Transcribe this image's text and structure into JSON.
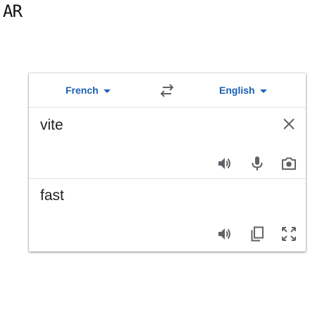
{
  "corner_label": "AR",
  "languages": {
    "source": "French",
    "target": "English"
  },
  "source": {
    "text": "vite"
  },
  "translation": {
    "text": "fast"
  },
  "icons": {
    "swap": "swap-arrows-icon",
    "clear": "close-icon",
    "source_speaker": "speaker-icon",
    "microphone": "microphone-icon",
    "camera": "camera-icon",
    "target_speaker": "speaker-icon",
    "copy": "copy-icon",
    "fullscreen": "fullscreen-icon"
  },
  "colors": {
    "accent": "#1a5fb4",
    "icon": "#5f6368",
    "text": "#202124"
  }
}
